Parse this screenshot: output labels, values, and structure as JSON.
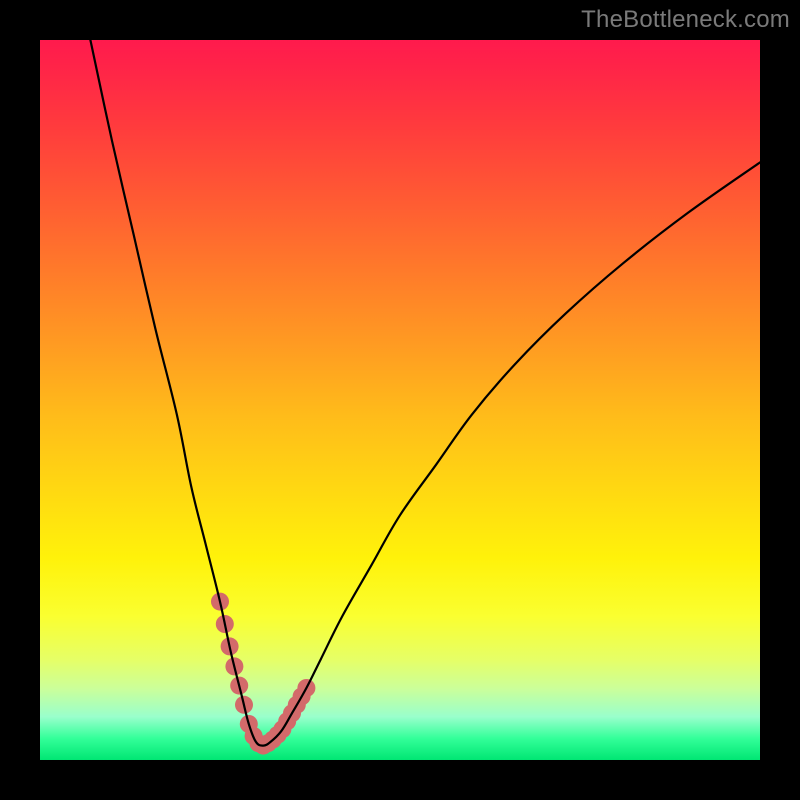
{
  "watermark": "TheBottleneck.com",
  "chart_data": {
    "type": "line",
    "title": "",
    "xlabel": "",
    "ylabel": "",
    "xlim": [
      0,
      100
    ],
    "ylim": [
      0,
      100
    ],
    "x": [
      7,
      10,
      13,
      16,
      19,
      21,
      23,
      25,
      26.5,
      28,
      29,
      30,
      31,
      32,
      33.5,
      35,
      37,
      39,
      42,
      46,
      50,
      55,
      60,
      66,
      73,
      81,
      90,
      100
    ],
    "values": [
      100,
      86,
      73,
      60,
      48,
      38,
      30,
      22,
      15,
      9,
      5,
      2.5,
      2,
      2.5,
      4,
      6.5,
      10,
      14,
      20,
      27,
      34,
      41,
      48,
      55,
      62,
      69,
      76,
      83
    ],
    "marker_range_x": [
      25,
      37
    ],
    "colors": {
      "curve": "#000000",
      "marker": "#d36a6a",
      "gradient_top": "#ff1a4d",
      "gradient_bottom": "#00e673"
    },
    "annotations": []
  }
}
